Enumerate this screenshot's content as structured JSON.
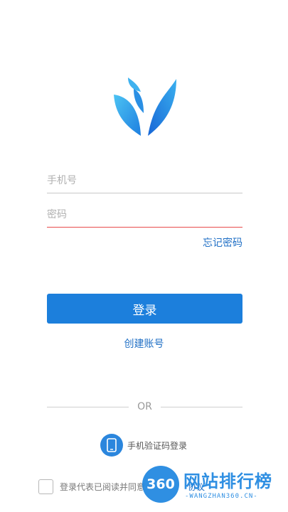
{
  "logo": {
    "icon": "leaf-logo-icon",
    "colors": {
      "light": "#3fb5ef",
      "dark": "#1a78db"
    }
  },
  "form": {
    "phone_placeholder": "手机号",
    "password_placeholder": "密码",
    "forgot_password": "忘记密码",
    "login_button": "登录",
    "create_account": "创建账号"
  },
  "divider": {
    "text": "OR"
  },
  "alt_login": {
    "icon": "phone-icon",
    "label": "手机验证码登录"
  },
  "agreement": {
    "prefix": "登录代表已阅读并同意",
    "link": "协议"
  },
  "watermark": {
    "badge": "360",
    "title": "网站排行榜",
    "subtitle": "-WANGZHAN360.CN-"
  },
  "colors": {
    "accent": "#1c7fdc",
    "link": "#1f6fc5",
    "error_underline": "#e94b4b"
  }
}
